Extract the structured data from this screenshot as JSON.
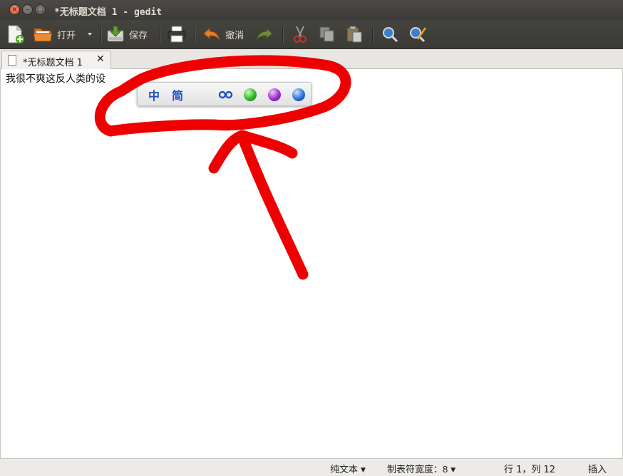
{
  "window": {
    "title": "*无标题文档 1 - gedit"
  },
  "window_buttons": {
    "close": "×",
    "minimize": "–",
    "maximize": "□"
  },
  "toolbar": {
    "open_label": "打开",
    "save_label": "保存",
    "undo_label": "撤消"
  },
  "tab": {
    "title": "*无标题文档 1",
    "close": "✕"
  },
  "editor": {
    "text": "我很不爽这反人类的设"
  },
  "ime_toolbar": {
    "chinese": "中",
    "simplified": "简"
  },
  "statusbar": {
    "language": "纯文本",
    "tab_width_label": "制表符宽度：",
    "tab_width_value": "8",
    "position": "行 1，列 12",
    "mode": "插入"
  },
  "colors": {
    "annotation": "#ee0000",
    "accent": "#1d50c2"
  }
}
